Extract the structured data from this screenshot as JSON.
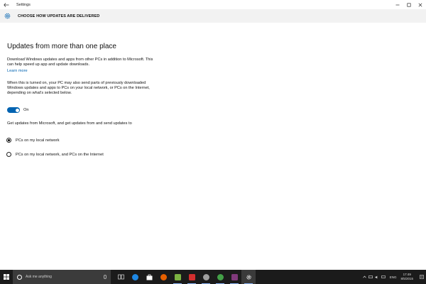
{
  "window": {
    "title": "Settings",
    "controls": {
      "minimize": "—",
      "maximize": "☐",
      "close": "✕"
    }
  },
  "header": {
    "title": "CHOOSE HOW UPDATES ARE DELIVERED",
    "icon": "gear-icon"
  },
  "main": {
    "heading": "Updates from more than one place",
    "description": "Download Windows updates and apps from other PCs in addition to Microsoft. This can help speed up app and update downloads.",
    "learn_more": "Learn more",
    "toggle_description": "When this is turned on, your PC may also send parts of previously downloaded Windows updates and apps to PCs on your local network, or PCs on the Internet, depending on what's selected below.",
    "toggle": {
      "state": "On",
      "on": true,
      "color": "#0063b1"
    },
    "options_label": "Get updates from Microsoft, and get updates from and send updates to",
    "options": [
      {
        "label": "PCs on my local network",
        "selected": true
      },
      {
        "label": "PCs on my local network, and PCs on the Internet",
        "selected": false
      }
    ]
  },
  "taskbar": {
    "search_placeholder": "Ask me anything",
    "apps": [
      "task-view",
      "edge",
      "store",
      "firefox",
      "app-green",
      "app-red",
      "app-media",
      "app-green-2",
      "onenote",
      "settings"
    ],
    "language": "ENG",
    "time": "17:49",
    "date": "8/5/2015"
  }
}
